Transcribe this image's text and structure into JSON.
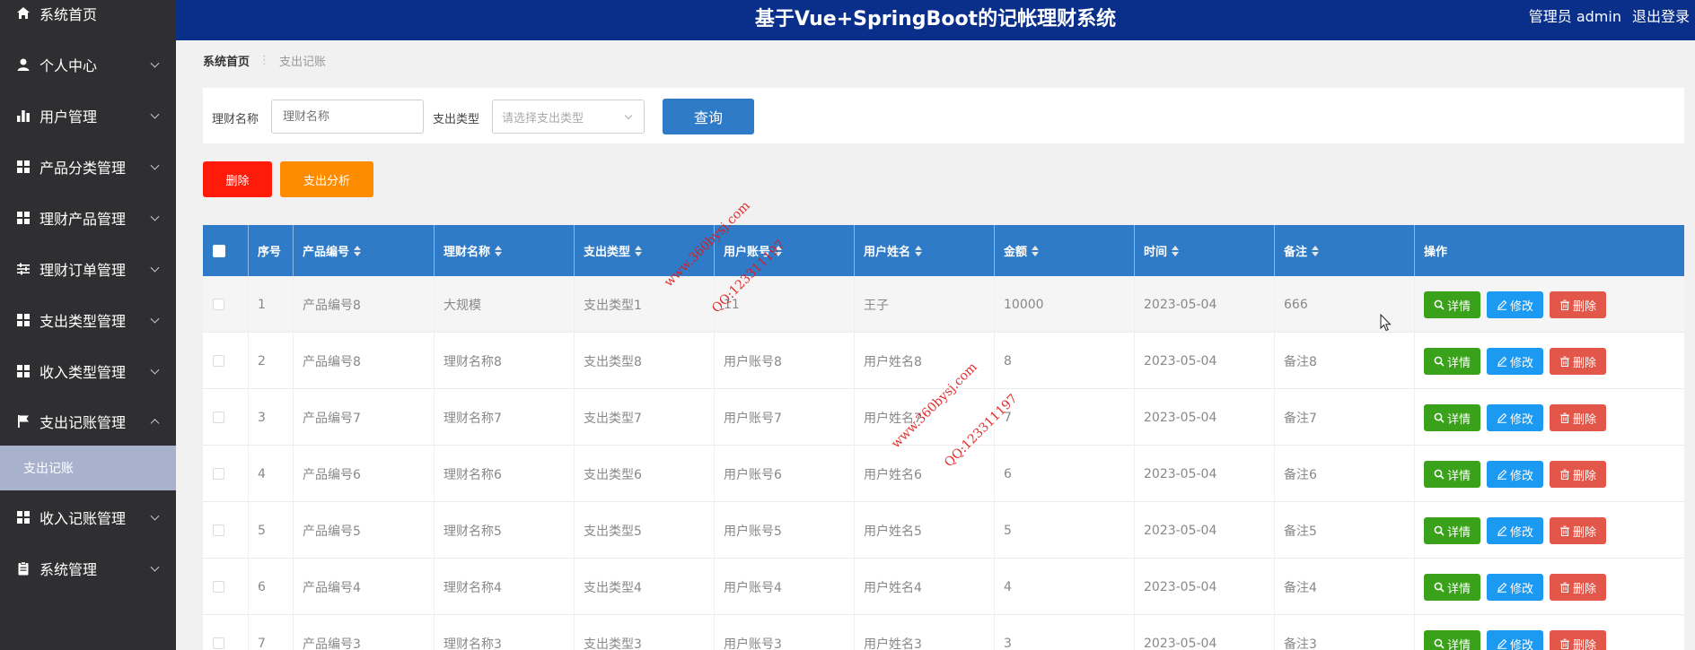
{
  "app": {
    "title": "基于Vue+SpringBoot的记帐理财系统"
  },
  "header": {
    "user_label": "管理员 admin",
    "logout_label": "退出登录"
  },
  "sidebar": {
    "items": [
      {
        "label": "系统首页",
        "icon": "home-icon"
      },
      {
        "label": "个人中心",
        "icon": "user-icon"
      },
      {
        "label": "用户管理",
        "icon": "bar-chart-icon"
      },
      {
        "label": "产品分类管理",
        "icon": "grid-icon"
      },
      {
        "label": "理财产品管理",
        "icon": "grid-icon"
      },
      {
        "label": "理财订单管理",
        "icon": "sliders-icon"
      },
      {
        "label": "支出类型管理",
        "icon": "grid-icon"
      },
      {
        "label": "收入类型管理",
        "icon": "grid-icon"
      },
      {
        "label": "支出记账管理",
        "icon": "flag-icon",
        "expanded": true
      },
      {
        "label": "收入记账管理",
        "icon": "grid-icon"
      },
      {
        "label": "系统管理",
        "icon": "clipboard-icon"
      }
    ],
    "sub_item": "支出记账"
  },
  "breadcrumb": {
    "home": "系统首页",
    "separator": "⋮",
    "current": "支出记账"
  },
  "search": {
    "name_label": "理财名称",
    "name_placeholder": "理财名称",
    "type_label": "支出类型",
    "type_placeholder": "请选择支出类型",
    "query_label": "查询"
  },
  "actions": {
    "delete_label": "删除",
    "analysis_label": "支出分析"
  },
  "table": {
    "headers": [
      "序号",
      "产品编号",
      "理财名称",
      "支出类型",
      "用户账号",
      "用户姓名",
      "金额",
      "时间",
      "备注",
      "操作"
    ],
    "row_buttons": {
      "detail": "详情",
      "edit": "修改",
      "delete": "删除"
    },
    "rows": [
      [
        "1",
        "产品编号8",
        "大规模",
        "支出类型1",
        "11",
        "王子",
        "10000",
        "2023-05-04",
        "666"
      ],
      [
        "2",
        "产品编号8",
        "理财名称8",
        "支出类型8",
        "用户账号8",
        "用户姓名8",
        "8",
        "2023-05-04",
        "备注8"
      ],
      [
        "3",
        "产品编号7",
        "理财名称7",
        "支出类型7",
        "用户账号7",
        "用户姓名7",
        "7",
        "2023-05-04",
        "备注7"
      ],
      [
        "4",
        "产品编号6",
        "理财名称6",
        "支出类型6",
        "用户账号6",
        "用户姓名6",
        "6",
        "2023-05-04",
        "备注6"
      ],
      [
        "5",
        "产品编号5",
        "理财名称5",
        "支出类型5",
        "用户账号5",
        "用户姓名5",
        "5",
        "2023-05-04",
        "备注5"
      ],
      [
        "6",
        "产品编号4",
        "理财名称4",
        "支出类型4",
        "用户账号4",
        "用户姓名4",
        "4",
        "2023-05-04",
        "备注4"
      ],
      [
        "7",
        "产品编号3",
        "理财名称3",
        "支出类型3",
        "用户账号3",
        "用户姓名3",
        "3",
        "2023-05-04",
        "备注3"
      ]
    ]
  },
  "watermark": {
    "site": "www.360bysj.com",
    "qq": "QQ:123311197"
  },
  "colors": {
    "sidebar_bg": "#2f2f31",
    "header_bg": "#0a2f8a",
    "table_header_bg": "#2f7bc8",
    "delete_btn": "#ff1a0a",
    "analysis_btn": "#ff8c00",
    "detail_btn": "#3aa21a",
    "edit_btn": "#1c9af2",
    "row_delete_btn": "#e2574a"
  }
}
